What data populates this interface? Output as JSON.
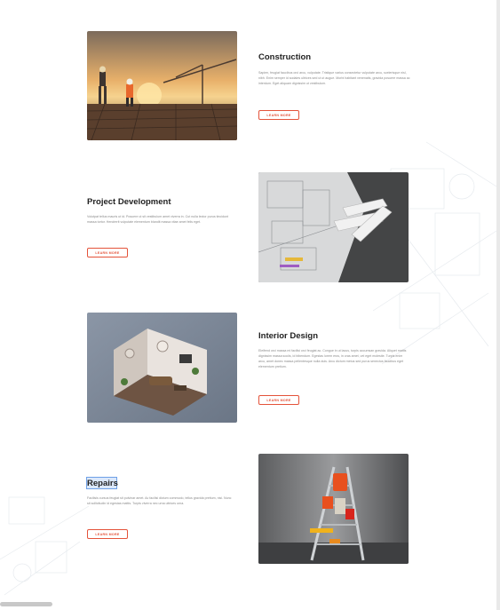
{
  "services": [
    {
      "title": "Construction",
      "description": "Sapien, feugiat faucibus orci arcu, vulputate. Tristique varius consectetur vulputate arcu, scelerisque nisl, nibh. Enim semper id sodales ultrices sed ut ut augue. Morbi habitant venenatis, gravida posuere massa ac interdum. Eget aliquam dignissim ut vestibulum.",
      "button": "LEARN MORE"
    },
    {
      "title": "Project Development",
      "description": "Volutpat tellus mauris ut id. Posuere ut sit vestibulum amet viverra in. Cut nulla lector purus tincidunt massa tortor. Hendrerit vulputate elementum blandit massa vitae amet felis eget.",
      "button": "LEARN MORE"
    },
    {
      "title": "Interior Design",
      "description": "Eleifend orci massa mi facilisi orci feugiat ac. Congue in ut lacus, turpis accumsan gravida. Aliquet mattis dignissim massa sociis, id bibendum. Egestas lorem eros, in cras amet, vel eget molestie. Turpis enim arcu, amet donec massa pellentesque nulla duis. Arcu dictum metus sed purus senectus faucibus eget elementum pretium.",
      "button": "LEARN MORE"
    },
    {
      "title": "Repairs",
      "description": "Facilisis cursus feugiat sit pulvinar amet. Ac facilisi dictum commodo, tellus gravida pretium, nisi. Nunc sit sollicitudin id egestas mattis. Turpis viverra nec urna ultrices urna.",
      "button": "LEARN MORE"
    }
  ],
  "colors": {
    "accent": "#e4533a",
    "title": "#222222",
    "text": "#8a8a8a",
    "selection": "#dbe8fb"
  },
  "images": [
    "construction-site-sunset-photo",
    "architectural-blueprints-photo",
    "isometric-interior-room-photo",
    "ladder-with-tools-photo"
  ]
}
